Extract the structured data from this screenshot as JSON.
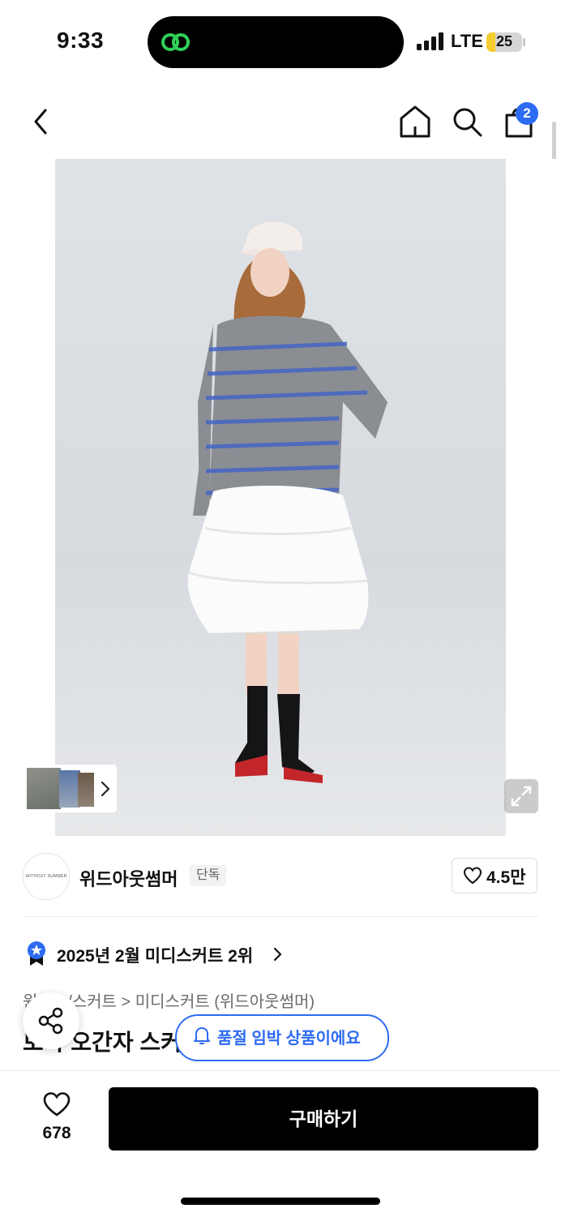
{
  "status_bar": {
    "time": "9:33",
    "network": "LTE",
    "battery": "25",
    "battery_level": 0.25
  },
  "nav": {
    "cart_count": "2"
  },
  "gallery": {
    "thumb_arrow": "›"
  },
  "brand": {
    "logo_text": "WITHOUT SUMMER",
    "name": "위드아웃썸머",
    "badge": "단독",
    "like_count": "4.5만"
  },
  "ranking": {
    "text": "2025년 2월 미디스커트 2위"
  },
  "breadcrumb": {
    "text": "원피스/스커트 > 미디스커트 (위드아웃썸머)"
  },
  "product": {
    "title": "보카 오간자 스커트"
  },
  "toast": {
    "text": "품절 임박 상품이에요"
  },
  "bottom_bar": {
    "wish_count": "678",
    "buy_label": "구매하기"
  },
  "colors": {
    "accent": "#2d6bf2",
    "buy_button": "#000000"
  },
  "icons": [
    "back-icon",
    "home-icon",
    "search-icon",
    "cart-icon",
    "expand-icon",
    "heart-icon",
    "star-badge-icon",
    "share-icon",
    "bell-icon"
  ]
}
